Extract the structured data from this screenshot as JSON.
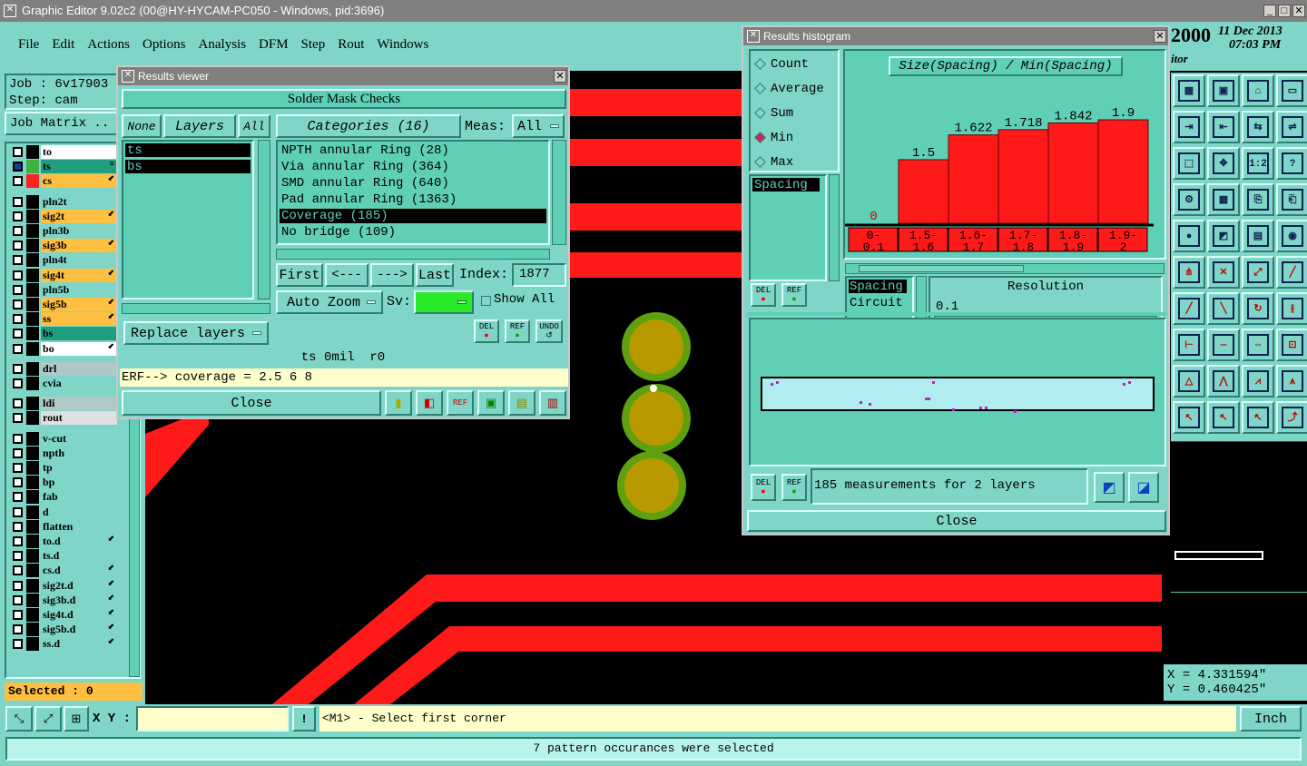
{
  "window": {
    "title": "Graphic Editor 9.02c2 (00@HY-HYCAM-PC050 - Windows, pid:3696)"
  },
  "menu": [
    "File",
    "Edit",
    "Actions",
    "Options",
    "Analysis",
    "DFM",
    "Step",
    "Rout",
    "Windows"
  ],
  "job": {
    "job_label": "Job : 6v17903",
    "step_label": "Step: cam",
    "matrix_button": "Job Matrix .."
  },
  "layers": [
    {
      "name": "to",
      "color": "#ffffff",
      "arrow": ""
    },
    {
      "name": "ts",
      "color": "#1f9f7f",
      "arrow": "≡"
    },
    {
      "name": "cs",
      "color": "#ffbf40",
      "arrow": "⬋"
    },
    {
      "name": "pln2t",
      "color": "#7fd6c8",
      "arrow": ""
    },
    {
      "name": "sig2t",
      "color": "#ffbf40",
      "arrow": "⬋"
    },
    {
      "name": "pln3b",
      "color": "#7fd6c8",
      "arrow": ""
    },
    {
      "name": "sig3b",
      "color": "#ffbf40",
      "arrow": "⬋"
    },
    {
      "name": "pln4t",
      "color": "#7fd6c8",
      "arrow": ""
    },
    {
      "name": "sig4t",
      "color": "#ffbf40",
      "arrow": "⬋"
    },
    {
      "name": "pln5b",
      "color": "#7fd6c8",
      "arrow": ""
    },
    {
      "name": "sig5b",
      "color": "#ffbf40",
      "arrow": "⬋"
    },
    {
      "name": "ss",
      "color": "#ffbf40",
      "arrow": "⬋"
    },
    {
      "name": "bs",
      "color": "#1f9f7f",
      "arrow": ""
    },
    {
      "name": "bo",
      "color": "#ffffff",
      "arrow": "⬋"
    },
    {
      "name": "drl",
      "color": "#b0c8c8",
      "arrow": ""
    },
    {
      "name": "cvia",
      "color": "#7fd6c8",
      "arrow": ""
    },
    {
      "name": "ldi",
      "color": "#b0c8c8",
      "arrow": ""
    },
    {
      "name": "rout",
      "color": "#e0e0e0",
      "arrow": ""
    },
    {
      "name": "v-cut",
      "color": "#7fd6c8",
      "arrow": ""
    },
    {
      "name": "npth",
      "color": "#7fd6c8",
      "arrow": ""
    },
    {
      "name": "tp",
      "color": "#7fd6c8",
      "arrow": ""
    },
    {
      "name": "bp",
      "color": "#7fd6c8",
      "arrow": ""
    },
    {
      "name": "fab",
      "color": "#7fd6c8",
      "arrow": ""
    },
    {
      "name": "d",
      "color": "#7fd6c8",
      "arrow": ""
    },
    {
      "name": "flatten",
      "color": "#7fd6c8",
      "arrow": ""
    },
    {
      "name": "to.d",
      "color": "#7fd6c8",
      "arrow": "⬋"
    },
    {
      "name": "ts.d",
      "color": "#7fd6c8",
      "arrow": ""
    },
    {
      "name": "cs.d",
      "color": "#7fd6c8",
      "arrow": "⬋"
    },
    {
      "name": "sig2t.d",
      "color": "#7fd6c8",
      "arrow": "⬋"
    },
    {
      "name": "sig3b.d",
      "color": "#7fd6c8",
      "arrow": "⬋"
    },
    {
      "name": "sig4t.d",
      "color": "#7fd6c8",
      "arrow": "⬋"
    },
    {
      "name": "sig5b.d",
      "color": "#7fd6c8",
      "arrow": "⬋"
    },
    {
      "name": "ss.d",
      "color": "#7fd6c8",
      "arrow": "⬋"
    }
  ],
  "selected_label": "Selected : 0",
  "results_viewer": {
    "title": "Results viewer",
    "header": "Solder Mask Checks",
    "none_btn": "None",
    "layers_btn": "Layers",
    "all_btn": "All",
    "layer_items": [
      "ts",
      "bs"
    ],
    "categories_btn": "Categories (16)",
    "meas_label": "Meas:",
    "meas_value": "All",
    "categories": [
      "NPTH annular Ring (28)",
      "Via annular Ring (364)",
      "SMD annular Ring (640)",
      "Pad annular Ring (1363)",
      "Coverage (185)",
      "No bridge (109)"
    ],
    "first": "First",
    "prev": "<---",
    "next": "--->",
    "last": "Last",
    "index_label": "Index:",
    "index_value": "1877",
    "auto_zoom": "Auto Zoom",
    "sv_label": "Sv:",
    "show_all": "Show All",
    "replace_layers": "Replace layers",
    "del": "DEL",
    "ref": "REF",
    "undo": "UNDO",
    "status_line": "ts 0mil  r0",
    "erf_line": "ERF--> coverage = 2.5 6 8",
    "close": "Close"
  },
  "histogram": {
    "title": "Results histogram",
    "modes": [
      "Count",
      "Average",
      "Sum",
      "Min",
      "Max"
    ],
    "selected_mode": "Min",
    "chart_title": "Size(Spacing) / Min(Spacing)",
    "spacing_item": "Spacing",
    "options": [
      "Spacing",
      "Circuit"
    ],
    "resolution_label": "Resolution",
    "resolution_value": "0.1",
    "del": "DEL",
    "ref": "REF",
    "summary": "185 measurements for 2 layers",
    "close": "Close"
  },
  "chart_data": {
    "type": "bar",
    "title": "Size(Spacing) / Min(Spacing)",
    "categories": [
      "0-0.1",
      "1.5-1.6",
      "1.6-1.7",
      "1.7-1.8",
      "1.8-1.9",
      "1.9-2"
    ],
    "values": [
      0,
      1.5,
      1.622,
      1.718,
      1.842,
      1.9
    ],
    "value_labels": [
      "0",
      "1.5",
      "1.622",
      "1.718",
      "1.842",
      "1.9"
    ],
    "ylim": [
      0,
      2
    ],
    "bar_color": "#ff1a1a"
  },
  "right_header": {
    "year": "2000",
    "date": "11 Dec 2013",
    "time": "07:03 PM",
    "app": "itor"
  },
  "coords": {
    "x": "X = 4.331594\"",
    "y": "Y = 0.460425\""
  },
  "bottom": {
    "xy_label": "X Y :",
    "xy_value": "",
    "prompt": "<M1> - Select first corner",
    "units": "Inch",
    "status": "7 pattern occurances were selected"
  },
  "tool_icons": [
    "stack-1",
    "stack-2",
    "home",
    "window",
    "move-1",
    "move-2",
    "copy",
    "arrange",
    "scale-1",
    "scale-2",
    "ratio",
    "help",
    "shape-1",
    "grid",
    "shape-3",
    "shape-4",
    "pad-1",
    "shape-6",
    "ruler",
    "circle",
    "net",
    "cross",
    "connect",
    "line-red",
    "draw-1",
    "line-blue",
    "arc",
    "split",
    "snap",
    "minus",
    "measure",
    "pads",
    "tri-1",
    "tri-2",
    "tri-3",
    "tri-4",
    "arrow-1",
    "arrow-2",
    "arrow-3",
    "route"
  ],
  "colors": {
    "panel": "#5fcfb6",
    "trace": "#ff1a1a",
    "pad_ring": "#5fa010",
    "pad_fill": "#b89a00"
  }
}
